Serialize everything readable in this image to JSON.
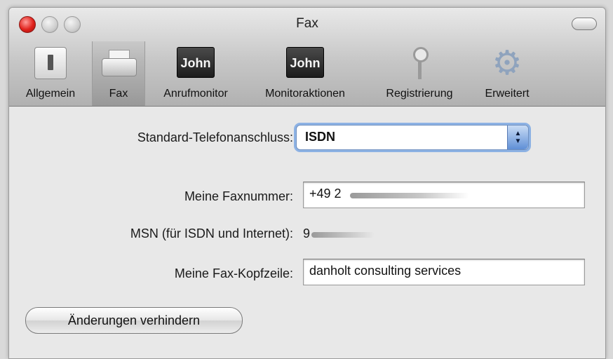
{
  "window": {
    "title": "Fax"
  },
  "toolbar": {
    "items": [
      {
        "label": "Allgemein"
      },
      {
        "label": "Fax"
      },
      {
        "label": "Anrufmonitor",
        "icon_text": "John"
      },
      {
        "label": "Monitoraktionen",
        "icon_text": "John"
      },
      {
        "label": "Registrierung"
      },
      {
        "label": "Erweitert"
      }
    ],
    "selected": "Fax"
  },
  "form": {
    "line_label": "Standard-Telefonanschluss:",
    "line_value": "ISDN",
    "fax_number_label": "Meine Faxnummer:",
    "fax_number_value": "+49 2",
    "msn_label": "MSN (für ISDN und Internet):",
    "msn_value": "9",
    "header_label": "Meine Fax-Kopfzeile:",
    "header_value": "danholt consulting services"
  },
  "lock_button": {
    "label": "Änderungen verhindern"
  },
  "colors": {
    "focus_ring": "#8db2e4",
    "close_button": "#e0211b"
  }
}
